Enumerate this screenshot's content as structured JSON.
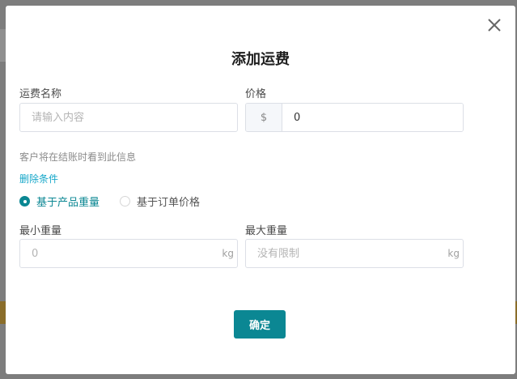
{
  "modal": {
    "title": "添加运费",
    "close_icon": "close-icon"
  },
  "fields": {
    "name_label": "运费名称",
    "name_placeholder": "请输入内容",
    "price_label": "价格",
    "price_prefix": "$",
    "price_value": "0"
  },
  "hint": "客户将在结账时看到此信息",
  "delete_condition": "删除条件",
  "radios": {
    "by_weight": "基于产品重量",
    "by_price": "基于订单价格",
    "selected": "by_weight"
  },
  "weights": {
    "min_label": "最小重量",
    "min_placeholder": "0",
    "max_label": "最大重量",
    "max_placeholder": "没有限制",
    "unit": "kg"
  },
  "confirm_label": "确定",
  "colors": {
    "accent": "#0b8793",
    "link": "#16a7c9"
  }
}
